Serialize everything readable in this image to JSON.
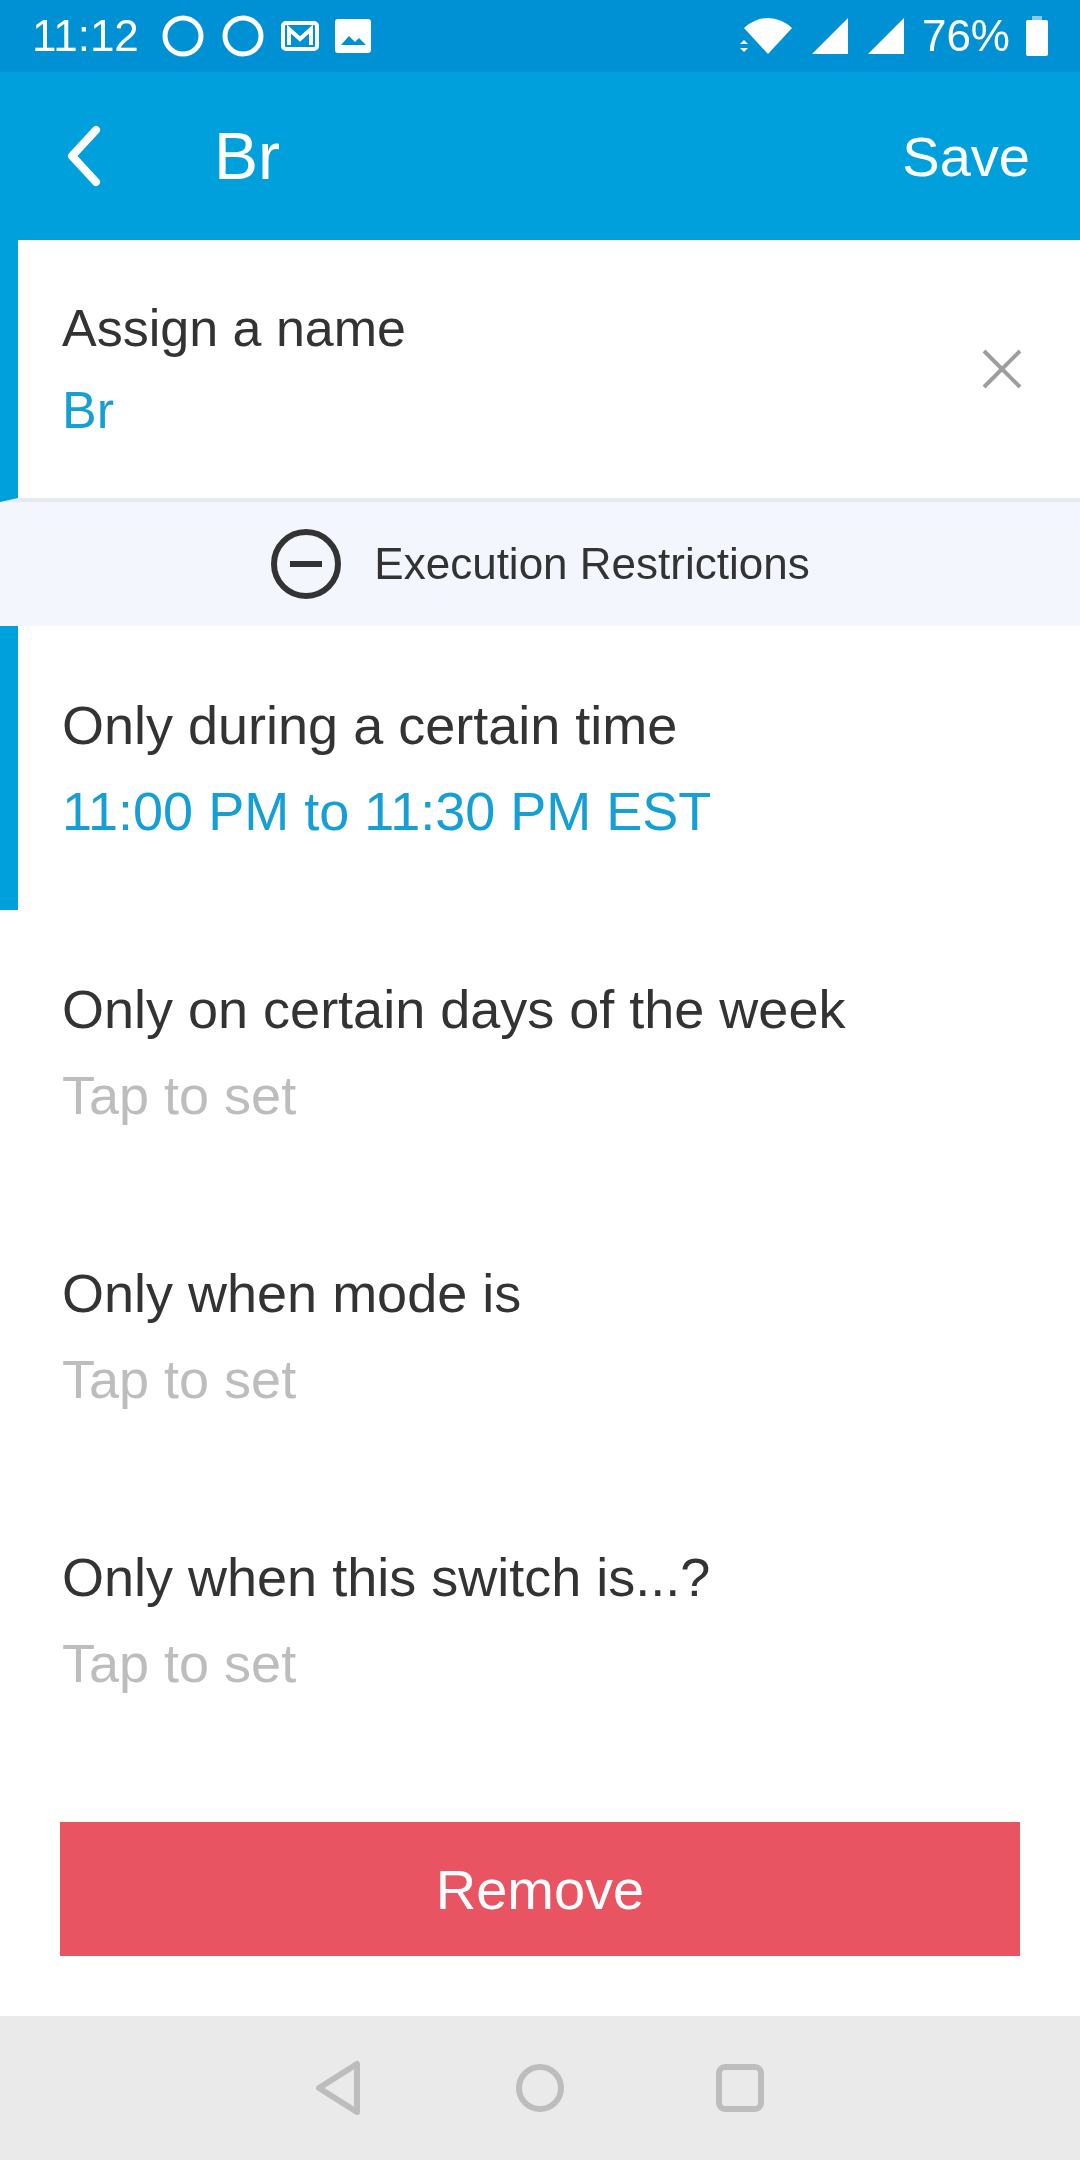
{
  "status_bar": {
    "time": "11:12",
    "battery": "76%"
  },
  "app_bar": {
    "title": "Br",
    "action": "Save"
  },
  "name_field": {
    "label": "Assign a name",
    "value": "Br"
  },
  "section": {
    "title": "Execution Restrictions",
    "expanded": true
  },
  "restrictions": [
    {
      "label": "Only during a certain time",
      "value": "11:00 PM to 11:30 PM EST",
      "set": true
    },
    {
      "label": "Only on certain days of the week",
      "value": "Tap to set",
      "set": false
    },
    {
      "label": "Only when mode is",
      "value": "Tap to set",
      "set": false
    },
    {
      "label": "Only when this switch is...?",
      "value": "Tap to set",
      "set": false
    }
  ],
  "remove_button": "Remove"
}
